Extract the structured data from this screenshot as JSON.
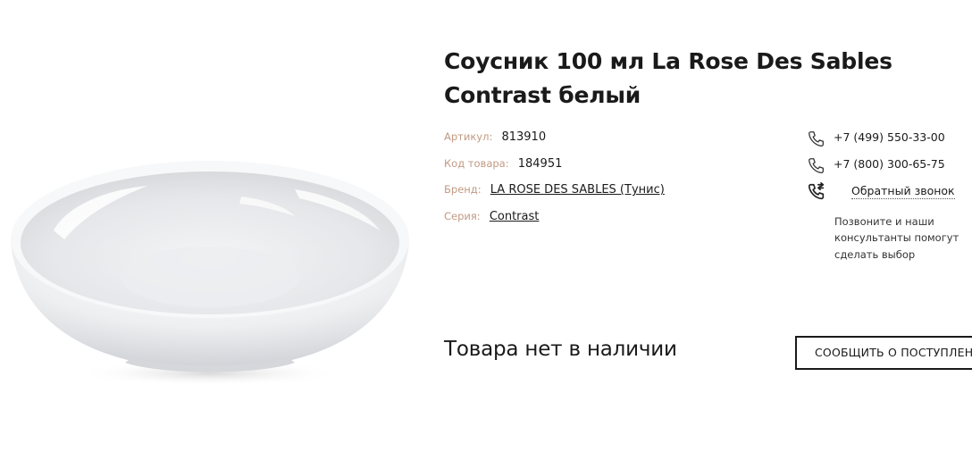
{
  "product": {
    "title": "Соусник 100 мл La Rose Des Sables Contrast белый",
    "image_alt": "white porcelain sauce bowl",
    "props": [
      {
        "label": "Артикул:",
        "value": "813910"
      },
      {
        "label": "Код товара:",
        "value": "184951"
      },
      {
        "label": "Бренд:",
        "value": "LA ROSE DES SABLES (Тунис)"
      },
      {
        "label": "Серия:",
        "value": "Contrast"
      }
    ]
  },
  "contacts": {
    "phone_1": "+7 (499) 550-33-00",
    "phone_2": "+7 (800) 300-65-75",
    "callback_label": "Обратный звонок",
    "note": "Позвоните и наши консультанты помогут сделать выбор"
  },
  "availability": {
    "status_text": "Товара нет в наличии",
    "notify_button_label": "СООБЩИТЬ О ПОСТУПЛЕНИИ"
  },
  "colors": {
    "label_color": "#c29a84",
    "text_color": "#1a1a1a"
  },
  "icons": [
    "phone-icon",
    "phone-icon",
    "callback-icon"
  ]
}
